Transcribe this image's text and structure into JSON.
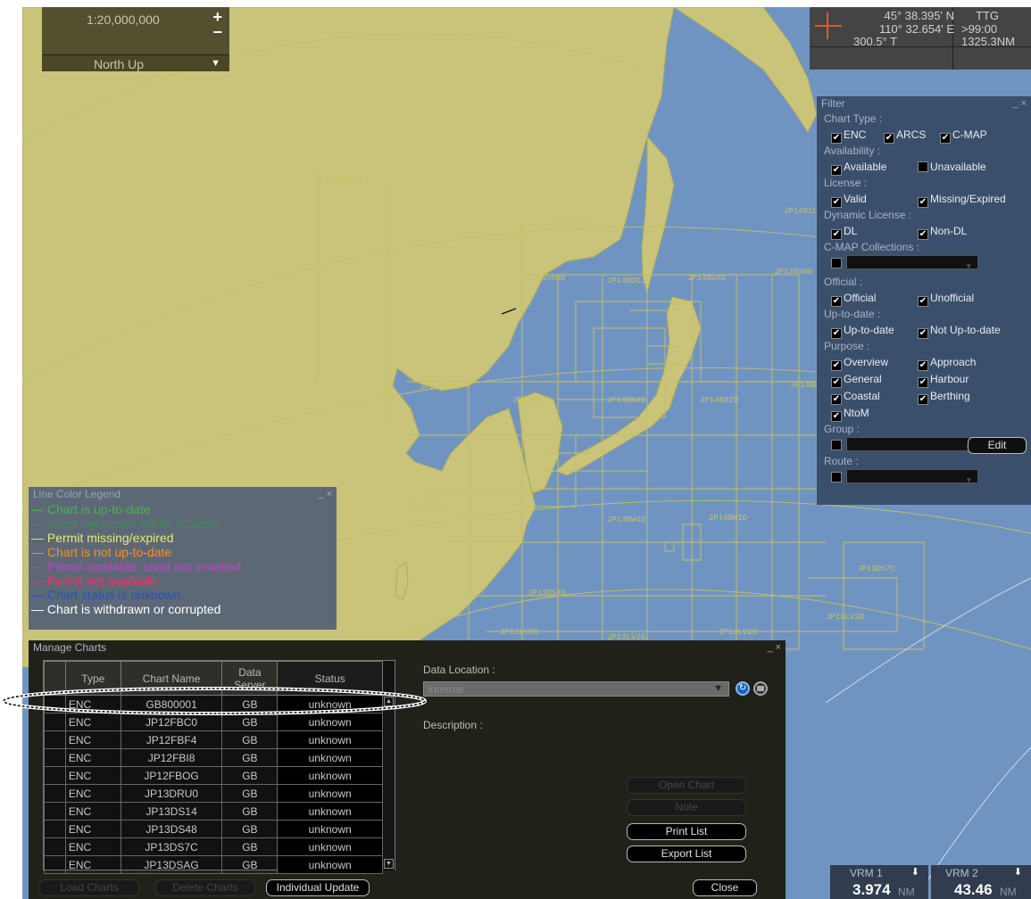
{
  "scale_box": {
    "scale": "1:20,000,000",
    "plus": "+",
    "minus": "−",
    "orientation": "North Up"
  },
  "nav_box": {
    "lat": "45° 38.395' N",
    "lon": "110° 32.654' E",
    "course": "300.5° T",
    "ttg_label": "TTG",
    "ttg_value": ">99:00",
    "distance": "1325.3NM"
  },
  "chart_labels": [
    "JP14CCJ4",
    "JP14CCMB",
    "JP145800",
    "JP14BDCJ",
    "JP14BU4O",
    "JP148800",
    "JP1401L7",
    "JP14BEAS",
    "JP13DS6B",
    "JP14BU20",
    "JP14BN40",
    "JP14BR20",
    "JP13BM20",
    "JP14BW4O",
    "JP14BWID",
    "JP13DS48",
    "JP13LV00",
    "JP13LV20",
    "JP13LV20",
    "JP13DS7C",
    "JP13LV20"
  ],
  "filter": {
    "title": "Filter",
    "close": "_ ×",
    "chart_type_label": "Chart Type :",
    "chart_types": [
      {
        "label": "ENC",
        "checked": true
      },
      {
        "label": "ARCS",
        "checked": true
      },
      {
        "label": "C-MAP",
        "checked": true
      }
    ],
    "availability_label": "Availability :",
    "availability": [
      {
        "label": "Available",
        "checked": true
      },
      {
        "label": "Unavailable",
        "checked": false
      }
    ],
    "license_label": "License :",
    "license": [
      {
        "label": "Valid",
        "checked": true
      },
      {
        "label": "Missing/Expired",
        "checked": true
      }
    ],
    "dynamic_license_label": "Dynamic License :",
    "dynamic_license": [
      {
        "label": "DL",
        "checked": true
      },
      {
        "label": "Non-DL",
        "checked": true
      }
    ],
    "cmap_collections_label": "C-MAP Collections :",
    "official_label": "Official :",
    "official": [
      {
        "label": "Official",
        "checked": true
      },
      {
        "label": "Unofficial",
        "checked": true
      }
    ],
    "up_to_date_label": "Up-to-date :",
    "up_to_date": [
      {
        "label": "Up-to-date",
        "checked": true
      },
      {
        "label": "Not Up-to-date",
        "checked": true
      }
    ],
    "purpose_label": "Purpose :",
    "purpose": [
      {
        "label": "Overview",
        "checked": true
      },
      {
        "label": "Approach",
        "checked": true
      },
      {
        "label": "General",
        "checked": true
      },
      {
        "label": "Harbour",
        "checked": true
      },
      {
        "label": "Coastal",
        "checked": true
      },
      {
        "label": "Berthing",
        "checked": true
      },
      {
        "label": "NtoM",
        "checked": true
      }
    ],
    "group_label": "Group :",
    "edit_button": "Edit",
    "route_label": "Route :"
  },
  "legend": {
    "title": "Line Color Legend",
    "close": "_ ×",
    "items": [
      {
        "text": "Chart is up-to-date",
        "color": "#4caf50"
      },
      {
        "text": "Chart will expire within 30 days",
        "color": "#3f8a58"
      },
      {
        "text": "Permit missing/expired",
        "color": "#e8e870"
      },
      {
        "text": "Chart is not up-to-date",
        "color": "#ff8c1a"
      },
      {
        "text": "Permit available; chart not installed",
        "color": "#c23fc2"
      },
      {
        "text": "Permit not available",
        "color": "#ff2a66"
      },
      {
        "text": "Chart status is unknown",
        "color": "#1f57b3"
      },
      {
        "text": "Chart is withdrawn or corrupted",
        "color": "#ffffff"
      }
    ]
  },
  "manage": {
    "title": "Manage Charts",
    "close": "_ ×",
    "columns": [
      "Type",
      "Chart Name",
      "Data Server",
      "Status"
    ],
    "rows": [
      [
        "ENC",
        "GB800001",
        "GB",
        "unknown"
      ],
      [
        "ENC",
        "JP12FBC0",
        "GB",
        "unknown"
      ],
      [
        "ENC",
        "JP12FBF4",
        "GB",
        "unknown"
      ],
      [
        "ENC",
        "JP12FBI8",
        "GB",
        "unknown"
      ],
      [
        "ENC",
        "JP12FBOG",
        "GB",
        "unknown"
      ],
      [
        "ENC",
        "JP13DRU0",
        "GB",
        "unknown"
      ],
      [
        "ENC",
        "JP13DS14",
        "GB",
        "unknown"
      ],
      [
        "ENC",
        "JP13DS48",
        "GB",
        "unknown"
      ],
      [
        "ENC",
        "JP13DS7C",
        "GB",
        "unknown"
      ],
      [
        "ENC",
        "JP13DSAG",
        "GB",
        "unknown"
      ]
    ],
    "data_location_label": "Data Location :",
    "data_location_value": "Internal",
    "description_label": "Description :",
    "open_chart": "Open Chart",
    "note": "Note",
    "print_list": "Print List",
    "export_list": "Export List",
    "load_charts": "Load Charts",
    "delete_charts": "Delete Charts",
    "individual_update": "Individual Update",
    "close_button": "Close"
  },
  "vrm1": {
    "label": "VRM 1",
    "value": "3.974",
    "unit": "NM"
  },
  "vrm2": {
    "label": "VRM 2",
    "value": "43.46",
    "unit": "NM"
  }
}
